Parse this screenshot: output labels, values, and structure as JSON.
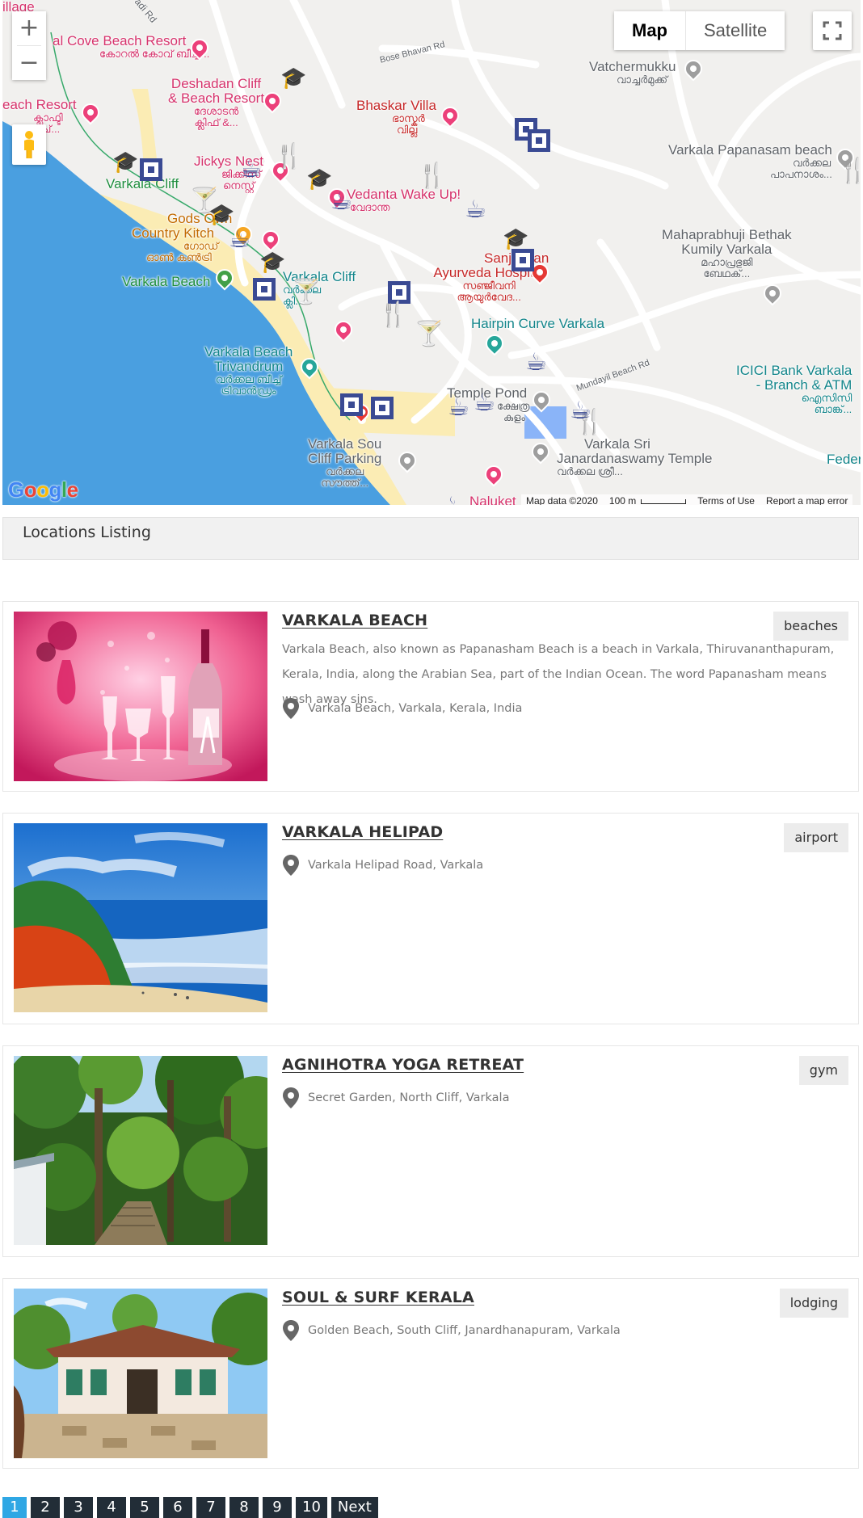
{
  "map": {
    "controls": {
      "zoom_in": "+",
      "zoom_out": "−",
      "type_map": "Map",
      "type_satellite": "Satellite"
    },
    "labels": {
      "cove_beach_resort": "al Cove Beach Resort",
      "cove_beach_resort_ml": "കോറൽ കോവ് ബീച്ച്...",
      "deshadan": "Deshadan Cliff",
      "deshadan2": "& Beach Resort",
      "deshadan_ml": "ദേശാടൻ",
      "deshadan_ml2": "ക്ലിഫ് &...",
      "each_resort": "each Resort",
      "each_resort_ml": "ക്ലാഫ്ടി",
      "each_resort_ml2": "ച്...",
      "bhaskar": "Bhaskar Villa",
      "bhaskar_ml": "ഭാസ്കർ",
      "bhaskar_ml2": "വില്ല",
      "vatchermukku": "Vatchermukku",
      "vatchermukku_ml": "വാച്ചർമുക്ക്",
      "bose_bhavan": "Bose Bhavan Rd",
      "papanasam": "Varkala Papanasam beach",
      "papanasam_ml": "വർക്കല",
      "papanasam_ml2": "പാപനാശം...",
      "jickys": "Jickys Nest",
      "jickys_ml": "ജിക്കിസ്",
      "jickys_ml2": "നെസ്റ്റ്",
      "varkala_cliff_left": "Varkala Cliff",
      "vedanta": "Vedanta Wake Up!",
      "vedanta_ml": "വേദാന്ത",
      "gods_own": "Gods Own",
      "country_kitchen": "Country Kitch",
      "country_ml": "ഗോഡ്",
      "country_ml2": "ഓൺ കൺട്രി",
      "mahaprabhuji": "Mahaprabhuji Bethak",
      "mahaprabhuji2": "Kumily Varkala",
      "mahaprabhuji_ml": "മഹാപ്രഭുജി",
      "mahaprabhuji_ml2": "ബേഥക്...",
      "sanjeevani": "Sanjeevan",
      "sanjeevani2": "Ayurveda Hospital",
      "sanjeevani_ml": "സഞ്ജീവനി",
      "sanjeevani_ml2": "ആയുർവേദ...",
      "varkala_beach": "Varkala Beach",
      "varkala_cliff": "Varkala Cliff",
      "varkala_cliff_ml": "വർക്കല",
      "varkala_cliff_ml2": "ക്ലി...",
      "hairpin": "Hairpin Curve Varkala",
      "beach_trivandrum": "Varkala Beach",
      "beach_trivandrum2": "Trivandrum",
      "beach_trivandrum_ml": "വർക്കല ബീച്ച്",
      "beach_trivandrum_ml2": "ട്രിവാൻഡ്രം",
      "icici": "ICICI Bank Varkala",
      "icici2": "- Branch & ATM",
      "icici_ml": "ഐസിസി",
      "icici_ml2": "ബാങ്ക്...",
      "temple_pond": "Temple Pond",
      "temple_pond_ml": "ക്ഷേത്ര",
      "temple_pond_ml2": "കുളം",
      "mundayil": "Mundayil Beach Rd",
      "south_cliff": "Varkala Sou",
      "south_cliff2": "Cliff Parking",
      "south_cliff_ml": "വർക്കല",
      "south_cliff_ml2": "സൗത്ത്...",
      "janardana": "Varkala Sri",
      "janardana2": "Janardanaswamy Temple",
      "janardana_ml": "വർക്കല ശ്രീ...",
      "feder": "Feder",
      "naluket": "Naluket",
      "bagh_top": "illage",
      "rd_top": "adi Rd"
    },
    "google_logo": "Google",
    "attribution": {
      "map_data": "Map data ©2020",
      "scale": "100 m",
      "terms": "Terms of Use",
      "report": "Report a map error"
    }
  },
  "listing": {
    "heading": "Locations Listing",
    "items": [
      {
        "title": "VARKALA BEACH",
        "tag": "beaches",
        "description": "Varkala Beach, also known as Papanasham Beach is a beach in Varkala, Thiruvananthapuram, Kerala, India, along the Arabian Sea, part of the Indian Ocean. The word Papanasham means wash away sins.",
        "address": "Varkala Beach, Varkala, Kerala, India"
      },
      {
        "title": "VARKALA HELIPAD",
        "tag": "airport",
        "description": "",
        "address": "Varkala Helipad Road, Varkala"
      },
      {
        "title": "AGNIHOTRA YOGA RETREAT",
        "tag": "gym",
        "description": "",
        "address": "Secret Garden, North Cliff, Varkala"
      },
      {
        "title": "SOUL & SURF KERALA",
        "tag": "lodging",
        "description": "",
        "address": "Golden Beach, South Cliff, Janardhanapuram, Varkala"
      }
    ]
  },
  "pagination": {
    "pages": [
      "1",
      "2",
      "3",
      "4",
      "5",
      "6",
      "7",
      "8",
      "9",
      "10"
    ],
    "current": "1",
    "next": "Next"
  },
  "icons": {
    "map_pin": "map-pin-icon",
    "fullscreen": "fullscreen-icon",
    "pegman": "pegman-icon"
  },
  "colors": {
    "water": "#4a9fe0",
    "sand": "#fbecb4",
    "poi_blue": "#3a4a93",
    "pager_active": "#2fa7e4",
    "pager_bg": "#222d37"
  }
}
